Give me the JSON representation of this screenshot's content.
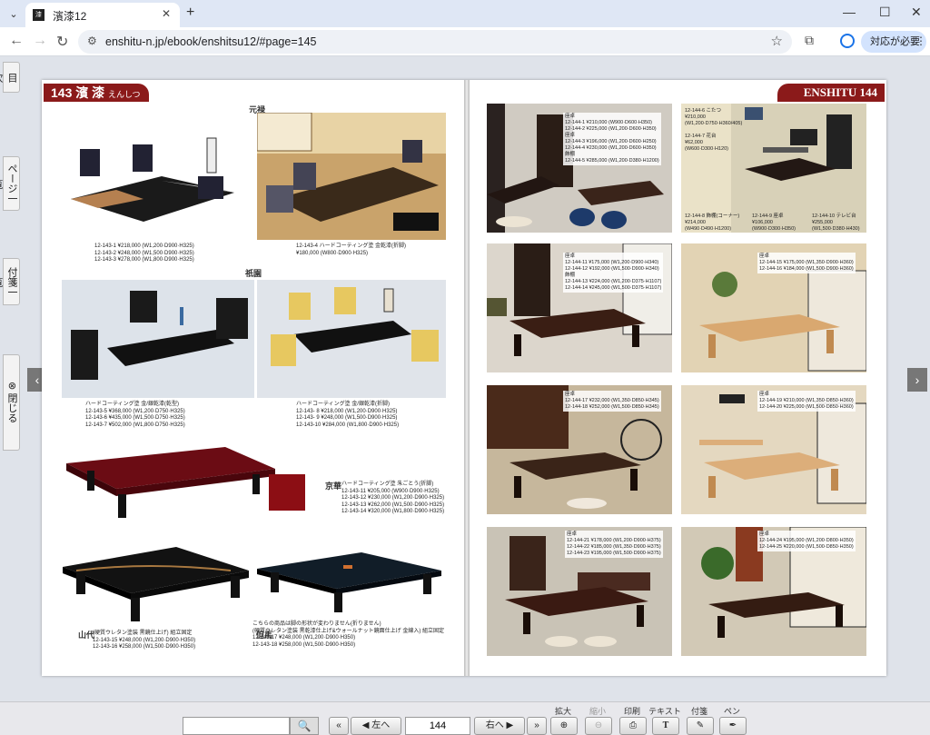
{
  "browser": {
    "tab_title": "濱漆12",
    "url": "enshitu-n.jp/ebook/enshitsu12/#page=145",
    "action_label": "対応が必要"
  },
  "sidebar": {
    "tabs": [
      "目次",
      "ページ一覧",
      "付箋一覧",
      "閉じる"
    ]
  },
  "left_page": {
    "num": "143",
    "title": "濱 漆",
    "ruby": "えんしつ",
    "sections": [
      "元禄",
      "祇園",
      "京華",
      "山代",
      "但馬"
    ],
    "cap1": "12-143-1 ¥218,000 (W1,200·D900·H325)\n12-143-2 ¥248,000 (W1,500·D900·H325)\n12-143-3 ¥278,000 (W1,800·D900·H325)",
    "cap2": "12-143-4 ハードコーティング塗 金乾漆(折脚)\n¥180,000 (W800·D900·H325)",
    "cap3": "ハードコーティング塗 金/銀乾漆(乾型)\n12-143-5 ¥368,000 (W1,200·D750·H325)\n12-143-6 ¥435,000 (W1,500·D750·H325)\n12-143-7 ¥502,000 (W1,800·D750·H325)",
    "cap4": "ハードコーティング塗 金/銀乾漆(折脚)\n12-143- 8 ¥218,000 (W1,200·D900·H325)\n12-143- 9 ¥248,000 (W1,500·D900·H325)\n12-143-10 ¥284,000 (W1,800·D900·H325)",
    "cap5": "ハードコーティング塗 朱ごとう(折脚)\n12-143-11 ¥205,000 (W900·D900·H325)\n12-143-12 ¥230,000 (W1,200·D900·H325)\n12-143-13 ¥262,000 (W1,500·D900·H325)\n12-143-14 ¥320,000 (W1,800·D900·H325)",
    "cap6": "(硬質ウレタン塗装 黒鏡仕上げ) 組立固定\n12-143-15 ¥248,000 (W1,200·D900·H350)\n12-143-16 ¥258,000 (W1,500·D900·H350)",
    "cap7": "こちらの商品は脚の形状が変わりません(折りません)\n(硬質ウレタン塗装 黒乾漆仕上げ&ウォールナット鏡面仕上げ 金線入) 組立固定\n12-143-17 ¥248,000 (W1,200·D900·H350)\n12-143-18 ¥258,000 (W1,500·D900·H350)"
  },
  "right_page": {
    "num": "144",
    "brand": "ENSHITU",
    "labels": [
      "座卓\n12-144-1 ¥210,000 (W900·D600·H350)\n12-144-2 ¥225,000 (W1,200·D600·H350)\n座卓\n12-144-3 ¥196,000 (W1,200·D600·H250)\n12-144-4 ¥230,000 (W1,200·D600·H350)\n飾棚\n12-144-5 ¥285,000 (W1,200·D380·H1200)",
      "12-144-6 こたつ\n¥210,000\n(W1,200·D750·H360/405)\n\n12-144-7 花台\n¥62,000\n(W600·D300·H120)",
      "12-144-8 飾棚(コーナー)\n¥214,000\n(W490·D490·H1200)",
      "12-144-9 座卓\n¥106,000\n(W900·D300·H350)",
      "12-144-10 テレビ台\n¥255,000\n(W1,500·D380·H430)",
      "座卓\n12-144-11 ¥175,000 (W1,200·D900·H340)\n12-144-12 ¥192,000 (W1,500·D900·H340)\n飾棚\n12-144-13 ¥224,000 (W1,200·D375·H1107)\n12-144-14 ¥245,000 (W1,500·D375·H1107)",
      "座卓\n12-144-15 ¥175,000 (W1,350·D900·H360)\n12-144-16 ¥184,000 (W1,500·D900·H360)",
      "座卓\n12-144-17 ¥232,000 (W1,350·D850·H345)\n12-144-18 ¥252,000 (W1,500·D850·H345)",
      "座卓\n12-144-19 ¥210,000 (W1,350·D850·H360)\n12-144-20 ¥225,000 (W1,500·D850·H360)",
      "座卓\n12-144-21 ¥178,000 (W1,200·D900·H375)\n12-144-22 ¥185,000 (W1,350·D900·H375)\n12-144-23 ¥195,000 (W1,500·D900·H375)",
      "座卓\n12-144-24 ¥195,000 (W1,200·D800·H350)\n12-144-25 ¥220,000 (W1,500·D850·H350)"
    ]
  },
  "controls": {
    "page": "144",
    "left": "左へ",
    "right": "右へ",
    "tools": [
      "拡大",
      "縮小",
      "印刷",
      "テキスト",
      "付箋",
      "ペン"
    ]
  }
}
